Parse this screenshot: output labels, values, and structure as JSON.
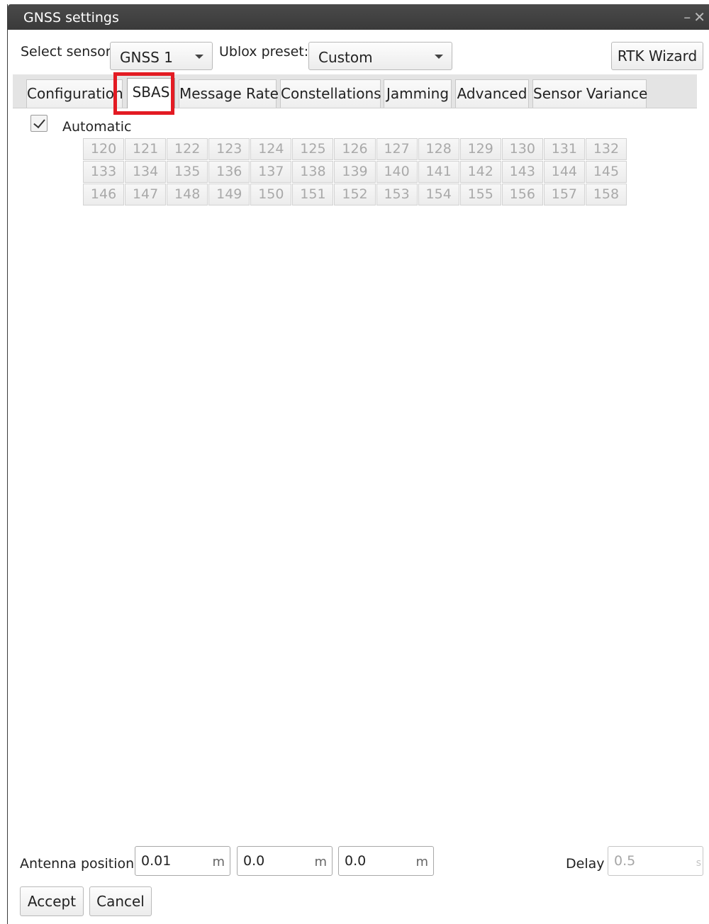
{
  "window": {
    "title": "GNSS settings"
  },
  "toolbar": {
    "select_sensor_label": "Select sensor",
    "sensor_value": "GNSS 1",
    "ublox_preset_label": "Ublox preset:",
    "ublox_preset_value": "Custom",
    "rtk_wizard_label": "RTK Wizard"
  },
  "tabs": [
    {
      "label": "Configuration",
      "active": false
    },
    {
      "label": "SBAS",
      "active": true
    },
    {
      "label": "Message Rate",
      "active": false
    },
    {
      "label": "Constellations",
      "active": false
    },
    {
      "label": "Jamming",
      "active": false
    },
    {
      "label": "Advanced",
      "active": false
    },
    {
      "label": "Sensor Variance",
      "active": false
    }
  ],
  "sbas": {
    "automatic_label": "Automatic",
    "automatic_checked": true,
    "prns": [
      "120",
      "121",
      "122",
      "123",
      "124",
      "125",
      "126",
      "127",
      "128",
      "129",
      "130",
      "131",
      "132",
      "133",
      "134",
      "135",
      "136",
      "137",
      "138",
      "139",
      "140",
      "141",
      "142",
      "143",
      "144",
      "145",
      "146",
      "147",
      "148",
      "149",
      "150",
      "151",
      "152",
      "153",
      "154",
      "155",
      "156",
      "157",
      "158"
    ],
    "prns_enabled": false
  },
  "footer": {
    "antenna_position_label": "Antenna position",
    "antenna_x": "0.01",
    "antenna_y": "0.0",
    "antenna_z": "0.0",
    "unit_m": "m",
    "delay_label": "Delay",
    "delay_value": "0.5",
    "delay_unit": "s",
    "accept_label": "Accept",
    "cancel_label": "Cancel"
  },
  "colors": {
    "highlight": "#e31b23",
    "titlebar": "#3f3f3f",
    "disabled_text": "#a9a9a9"
  }
}
